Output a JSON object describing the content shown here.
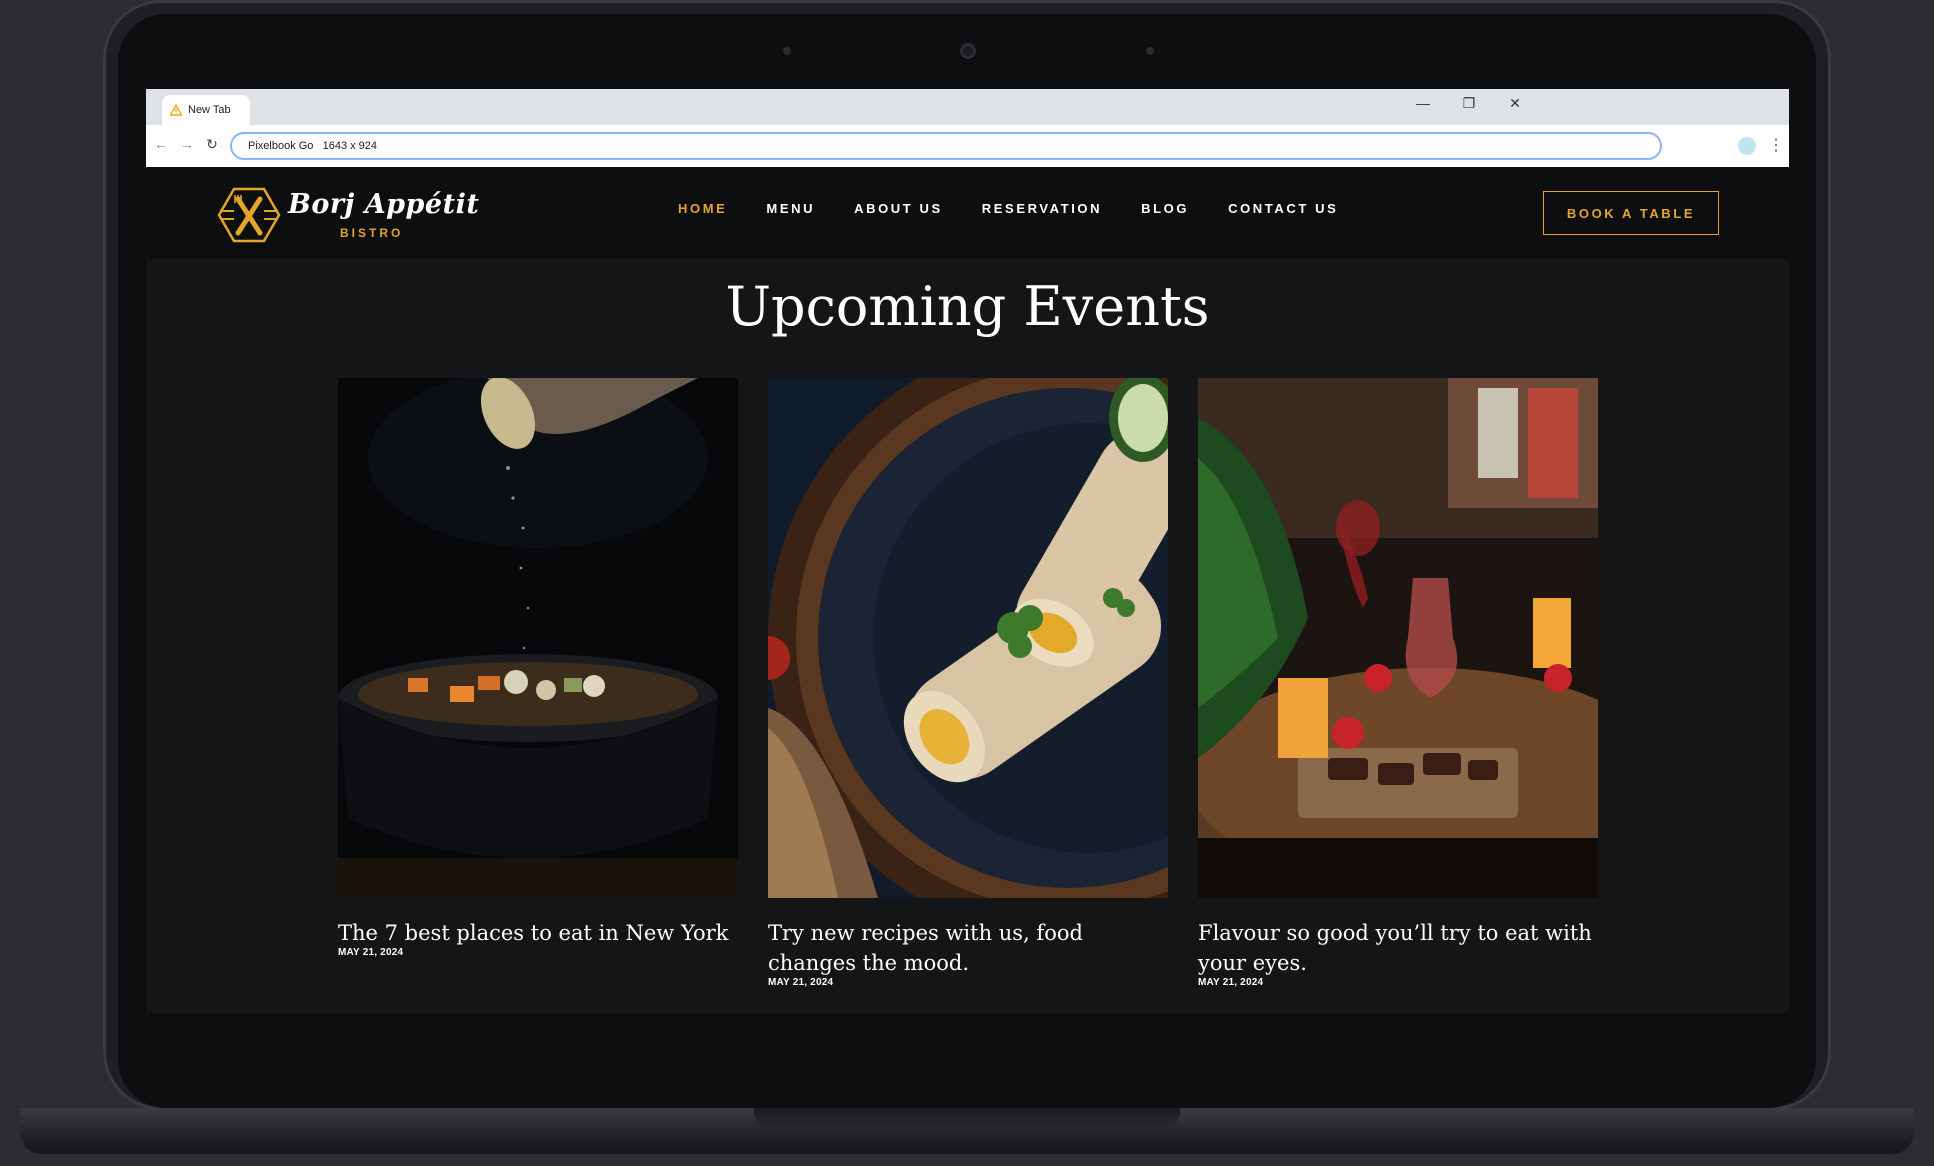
{
  "browser": {
    "tab_title": "New Tab",
    "address": "Pixelbook Go   1643 x 924",
    "controls": {
      "minimize": "—",
      "restore": "❐",
      "close": "✕"
    },
    "nav": {
      "back": "←",
      "forward": "→",
      "reload": "↻",
      "menu": "⋮"
    }
  },
  "site": {
    "brand": {
      "name": "Borj Appétit",
      "tagline": "BISTRO"
    },
    "nav": [
      {
        "label": "HOME",
        "active": true
      },
      {
        "label": "MENU",
        "active": false
      },
      {
        "label": "ABOUT US",
        "active": false
      },
      {
        "label": "RESERVATION",
        "active": false
      },
      {
        "label": "BLOG",
        "active": false
      },
      {
        "label": "CONTACT US",
        "active": false
      }
    ],
    "cta_label": "BOOK A TABLE",
    "accent_color": "#e5a42b"
  },
  "events": {
    "title": "Upcoming Events",
    "cards": [
      {
        "title": "The 7 best places to eat in New York",
        "date": "MAY 21, 2024",
        "image": "soup-bowl-lemon-squeeze"
      },
      {
        "title": "Try new recipes with us, food changes the mood.",
        "date": "MAY 21, 2024",
        "image": "stuffed-wraps-plate"
      },
      {
        "title": "Flavour so good you’ll try to eat with your eyes.",
        "date": "MAY 21, 2024",
        "image": "restaurant-table-spread"
      }
    ]
  }
}
